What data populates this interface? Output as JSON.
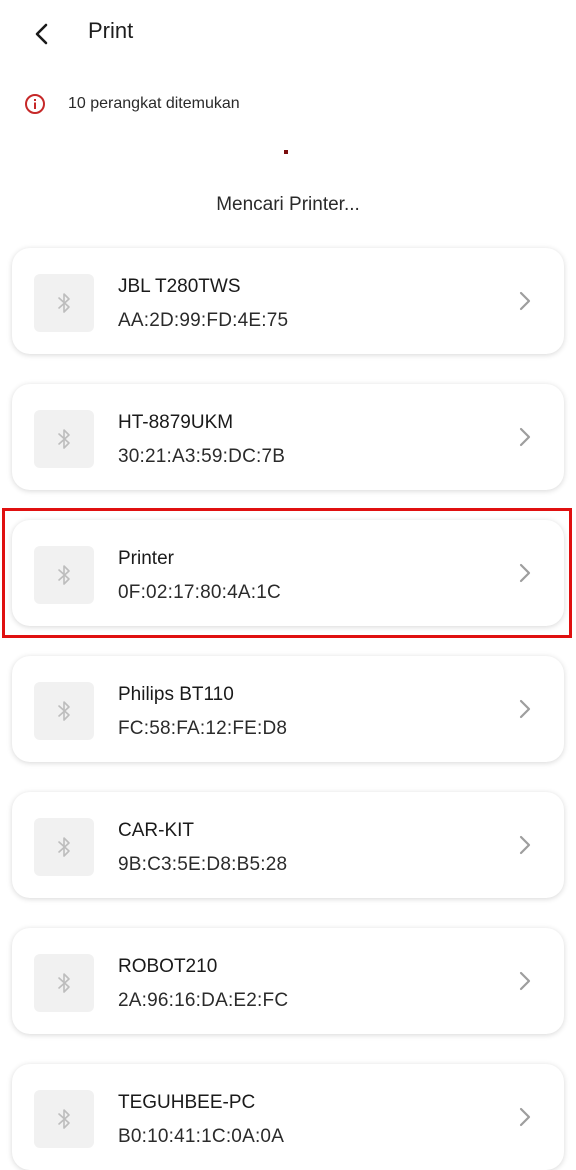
{
  "appbar": {
    "title": "Print",
    "back_icon": "chevron-left-icon"
  },
  "status": {
    "icon": "info-circle-icon",
    "text": "10 perangkat ditemukan",
    "icon_color": "#c62828"
  },
  "searching_text": "Mencari Printer...",
  "devices": [
    {
      "name": "JBL T280TWS",
      "mac": "AA:2D:99:FD:4E:75"
    },
    {
      "name": "HT-8879UKM",
      "mac": "30:21:A3:59:DC:7B"
    },
    {
      "name": "Printer",
      "mac": "0F:02:17:80:4A:1C"
    },
    {
      "name": "Philips BT110",
      "mac": "FC:58:FA:12:FE:D8"
    },
    {
      "name": "CAR-KIT",
      "mac": "9B:C3:5E:D8:B5:28"
    },
    {
      "name": "ROBOT210",
      "mac": "2A:96:16:DA:E2:FC"
    },
    {
      "name": "TEGUHBEE-PC",
      "mac": "B0:10:41:1C:0A:0A"
    }
  ],
  "highlight_color": "#e01010"
}
